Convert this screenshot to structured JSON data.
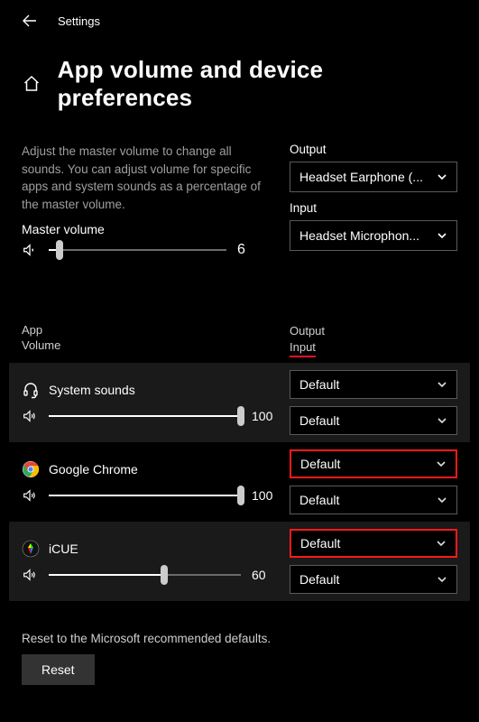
{
  "topbar": {
    "title": "Settings"
  },
  "header": {
    "title": "App volume and device preferences"
  },
  "description": "Adjust the master volume to change all sounds. You can adjust volume for specific apps and system sounds as a percentage of the master volume.",
  "master": {
    "label": "Master volume",
    "value": 6
  },
  "global": {
    "output_label": "Output",
    "output_value": "Headset Earphone (...",
    "input_label": "Input",
    "input_value": "Headset Microphon..."
  },
  "table_headers": {
    "app": "App",
    "volume": "Volume",
    "output": "Output",
    "input": "Input"
  },
  "apps": [
    {
      "name": "System sounds",
      "volume": 100,
      "output": "Default",
      "input": "Default",
      "hl_out": false,
      "hl_in": false
    },
    {
      "name": "Google Chrome",
      "volume": 100,
      "output": "Default",
      "input": "Default",
      "hl_out": true,
      "hl_in": false
    },
    {
      "name": "iCUE",
      "volume": 60,
      "output": "Default",
      "input": "Default",
      "hl_out": true,
      "hl_in": false
    }
  ],
  "reset": {
    "desc": "Reset to the Microsoft recommended defaults.",
    "button": "Reset"
  },
  "icons": {
    "back": "back-arrow",
    "home": "home",
    "speaker": "speaker",
    "chevron": "chevron-down",
    "headset": "headset",
    "chrome": "chrome",
    "icue": "icue"
  }
}
